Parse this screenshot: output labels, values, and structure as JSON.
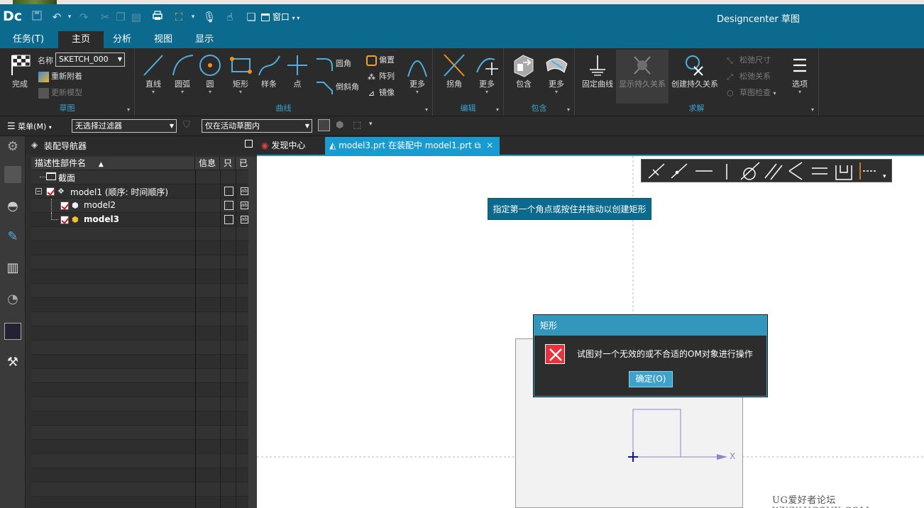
{
  "app": {
    "logo": "Dc",
    "title": "Designcenter 草图",
    "window_menu": "窗口"
  },
  "menu_tabs": [
    {
      "label": "任务(T)"
    },
    {
      "label": "主页"
    },
    {
      "label": "分析"
    },
    {
      "label": "视图"
    },
    {
      "label": "显示"
    }
  ],
  "ribbon": {
    "sketch_group": {
      "label": "草图",
      "finish": "完成",
      "name_label": "名称",
      "name_value": "SKETCH_000",
      "reattach": "重新附着",
      "update_model": "更新模型"
    },
    "curve_group": {
      "label": "曲线",
      "line": "直线",
      "arc": "圆弧",
      "circle": "圆",
      "rectangle": "矩形",
      "spline": "样条",
      "point": "点",
      "fillet": "圆角",
      "chamfer": "倒斜角",
      "offset": "偏置",
      "pattern": "阵列",
      "mirror": "镜像",
      "more": "更多"
    },
    "edit_group": {
      "label": "编辑",
      "corner": "拐角",
      "more": "更多"
    },
    "include_group": {
      "label": "包含",
      "include": "包含",
      "more": "更多"
    },
    "solve_group": {
      "label": "求解",
      "fix_curve": "固定曲线",
      "show_persistent": "显示持久关系",
      "create_persistent": "创建持久关系",
      "relax_dims": "松弛尺寸",
      "relax_rels": "松弛关系",
      "sketch_check": "草图检查",
      "options": "选项"
    }
  },
  "toolrow": {
    "menu": "菜单(M)",
    "filter": "无选择过滤器",
    "scope": "仅在活动草图内"
  },
  "navigator": {
    "title": "装配导航器",
    "columns": [
      "描述性部件名",
      "信息",
      "只",
      "已"
    ],
    "tree": [
      {
        "label": "截面"
      },
      {
        "label": "model1 (顺序: 时间顺序)"
      },
      {
        "label": "model2"
      },
      {
        "label": "model3"
      }
    ]
  },
  "doc_tabs": [
    {
      "label": "发现中心"
    },
    {
      "label": "model3.prt 在装配中 model1.prt"
    }
  ],
  "canvas": {
    "hint": "指定第一个角点或按住并拖动以创建矩形",
    "axis_x": "X"
  },
  "dialog": {
    "title": "矩形",
    "message": "试图对一个无效的或不合适的OM对象进行操作",
    "ok": "确定(O)"
  },
  "watermark": "UG爱好者论坛 WWW.UGSNX.COM",
  "colors": {
    "titlebar": "#0b6a8e",
    "accent": "#37a4d0",
    "error": "#e6333c",
    "dialog_title": "#3397bd"
  }
}
